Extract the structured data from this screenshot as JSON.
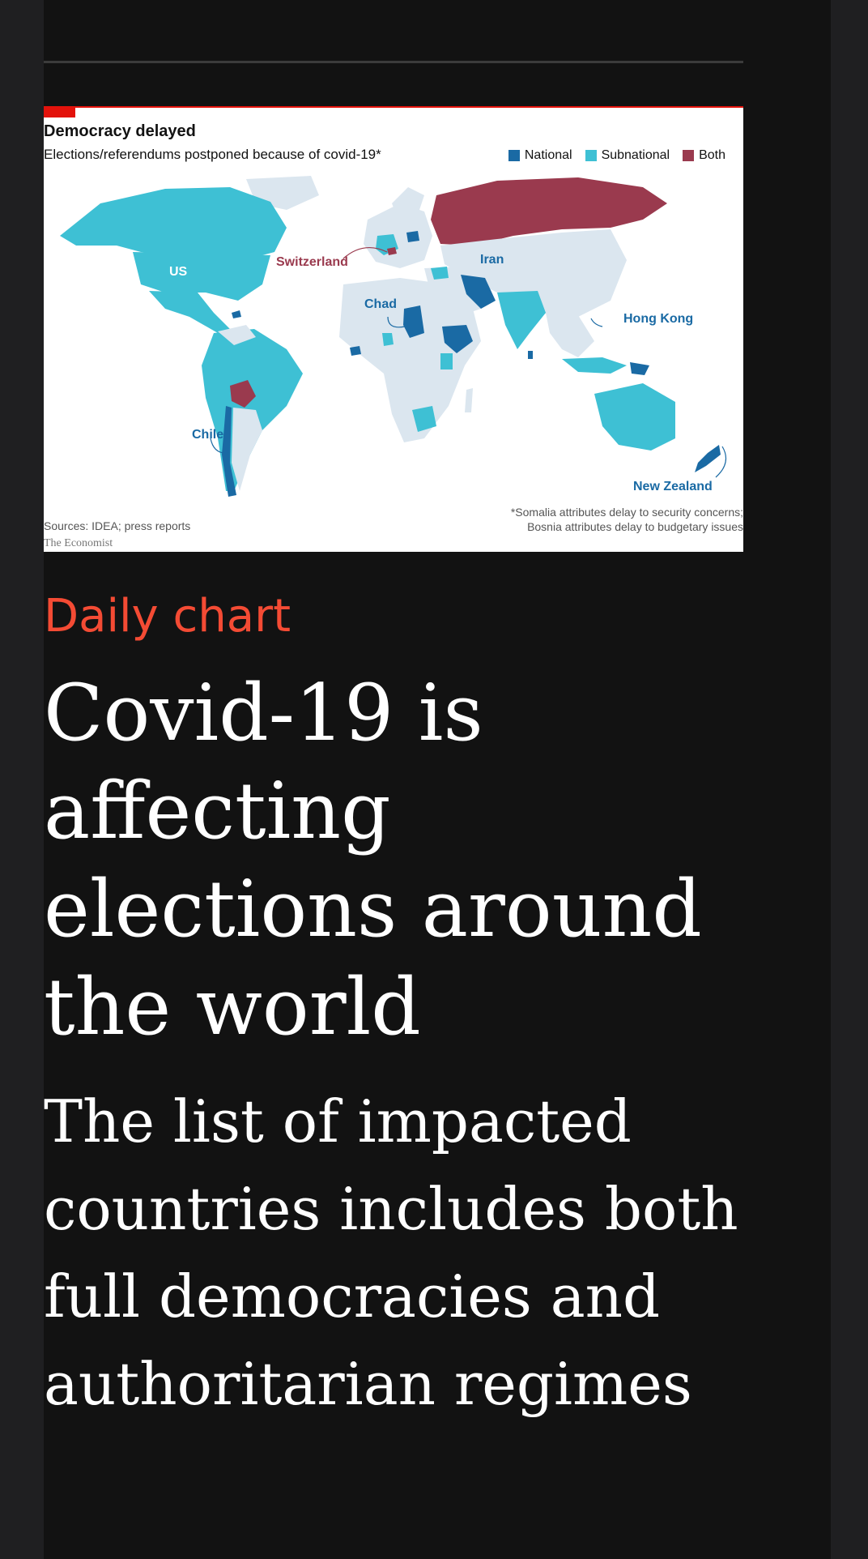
{
  "chart": {
    "title": "Democracy delayed",
    "subtitle": "Elections/referendums postponed because of covid-19*",
    "legend": [
      {
        "label": "National",
        "color": "#1a6aa4"
      },
      {
        "label": "Subnational",
        "color": "#3ec0d4"
      },
      {
        "label": "Both",
        "color": "#9a3a4e"
      }
    ],
    "labels": {
      "us": "US",
      "switzerland": "Switzerland",
      "iran": "Iran",
      "chad": "Chad",
      "hong_kong": "Hong Kong",
      "chile": "Chile",
      "new_zealand": "New Zealand"
    },
    "sources": "Sources: IDEA; press reports",
    "footnote_line1": "*Somalia attributes delay to security concerns;",
    "footnote_line2": "Bosnia attributes delay to budgetary issues",
    "brand": "The Economist"
  },
  "article": {
    "kicker": "Daily chart",
    "headline": "Covid-19 is affecting elections around the world",
    "standfirst": "The list of impacted countries includes both full democracies and authoritarian regimes"
  },
  "colors": {
    "national": "#1a6aa4",
    "subnational": "#3ec0d4",
    "both": "#9a3a4e",
    "land": "#dbe6ef",
    "kicker": "#f44b34"
  }
}
